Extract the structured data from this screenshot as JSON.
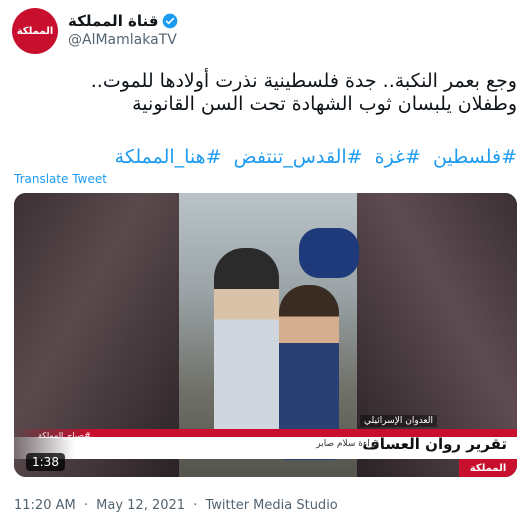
{
  "account": {
    "display_name": "قناة المملكة",
    "handle": "@AlMamlakaTV",
    "avatar_text": "المملكة"
  },
  "tweet": {
    "line1": "وجع بعمر النكبة.. جدة فلسطينية نذرت أولادها للموت..",
    "line2": "وطفلان يلبسان ثوب الشهادة تحت السن القانونية",
    "hashtags": [
      "#فلسطين",
      "#غزة",
      "#القدس_تنتفض",
      "#هنا_المملكة"
    ],
    "translate_label": "Translate Tweet"
  },
  "video": {
    "duration": "1:38",
    "category": "العدوان الإسرائيلي",
    "report_title": "تقرير روان العساف",
    "reader": "قراءة سلام صابر",
    "show_name": "#صباح_المملكة",
    "logo": "المملكة"
  },
  "meta": {
    "time": "11:20 AM",
    "date": "May 12, 2021",
    "source": "Twitter Media Studio",
    "separator": "·"
  },
  "colors": {
    "brand_red": "#c8102e",
    "link_blue": "#1d9bf0",
    "muted": "#536471"
  }
}
